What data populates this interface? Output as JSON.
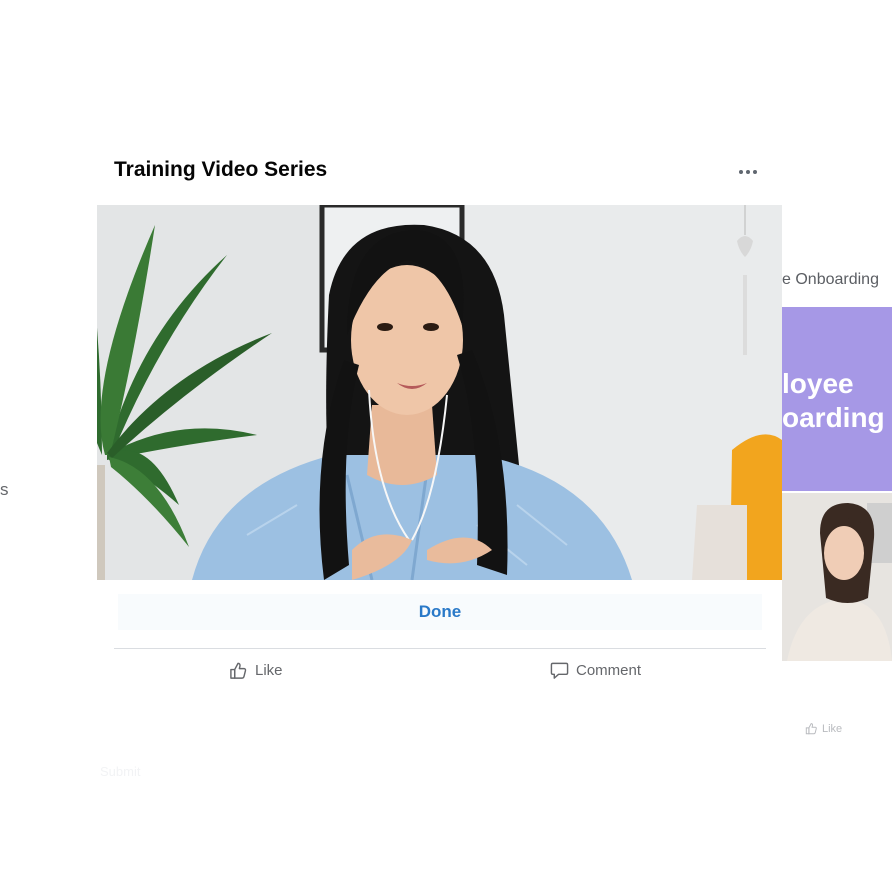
{
  "main_card": {
    "title": "Training Video Series",
    "video_thumbnail_icon": "video-still-woman-speaking",
    "done_label": "Done",
    "like_label": "Like",
    "comment_label": "Comment"
  },
  "left_card": {
    "peek_text": "s"
  },
  "right_card": {
    "title": "e Onboarding",
    "banner_line_1": "loyee",
    "banner_line_2": "oarding",
    "banner_color": "#a698e6",
    "like_label": "Like"
  },
  "faded": {
    "submit_label": "Submit"
  },
  "colors": {
    "accent_blue": "#2a79c8",
    "muted_text": "#65676b"
  }
}
